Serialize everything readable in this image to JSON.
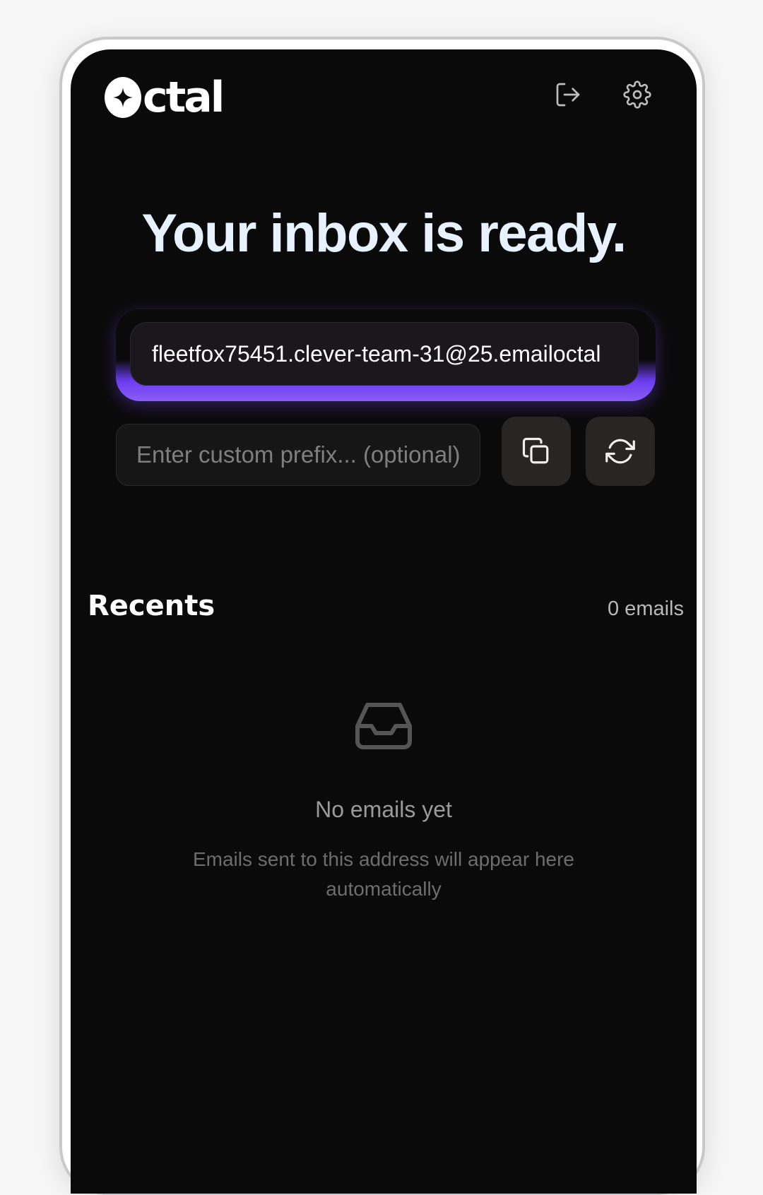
{
  "app": {
    "logo_text": "ctal"
  },
  "header": {
    "logout_icon": "logout-icon",
    "settings_icon": "gear-icon"
  },
  "hero": {
    "headline": "Your inbox is ready."
  },
  "address": {
    "value": "fleetfox75451.clever-team-31@25.emailoctal"
  },
  "prefix": {
    "placeholder": "Enter custom prefix... (optional)",
    "value": ""
  },
  "actions": {
    "copy_icon": "copy-icon",
    "refresh_icon": "refresh-icon"
  },
  "recents": {
    "title": "Recents",
    "count": "0 emails"
  },
  "empty_state": {
    "icon": "inbox-icon",
    "title": "No emails yet",
    "subtitle": "Emails sent to this address will appear here automatically"
  },
  "colors": {
    "background": "#0a0a0a",
    "accent": "#8b5cf6",
    "headline": "#e8f1ff"
  }
}
